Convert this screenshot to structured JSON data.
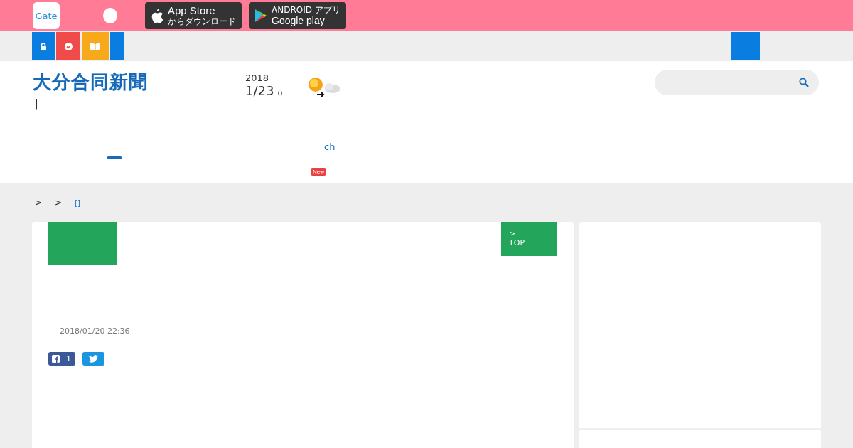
{
  "top_bar": {
    "app_icon": {
      "label": "Gate"
    },
    "store_badges": [
      {
        "kind": "apple",
        "title": "App Store",
        "subtitle": "からダウンロード"
      },
      {
        "kind": "google",
        "title": "Google play",
        "subtitle": "ANDROID アプリ"
      }
    ]
  },
  "sub_bar": {
    "tiles": [
      {
        "kind": "lock",
        "color": "#0a7de0"
      },
      {
        "kind": "check",
        "color": "#f04a4a"
      },
      {
        "kind": "book",
        "color": "#f7a81b"
      },
      {
        "kind": "blank",
        "color": "#0a7de0"
      }
    ]
  },
  "header": {
    "logo": "大分合同新聞",
    "tagline": "|",
    "date": {
      "year": "2018",
      "day": "1/23",
      "weekday": "()"
    }
  },
  "nav": {
    "items": [
      {
        "label": "ch"
      }
    ],
    "badge": "New"
  },
  "breadcrumb": [
    {
      "label": ">",
      "link": false
    },
    {
      "label": ">",
      "link": false
    },
    {
      "label": "[]",
      "link": true
    }
  ],
  "article": {
    "top_button": {
      "arrow": ">",
      "label": "TOP"
    },
    "timestamp": "2018/01/20 22:36",
    "share": [
      {
        "kind": "facebook",
        "count": "1"
      },
      {
        "kind": "twitter"
      }
    ]
  }
}
